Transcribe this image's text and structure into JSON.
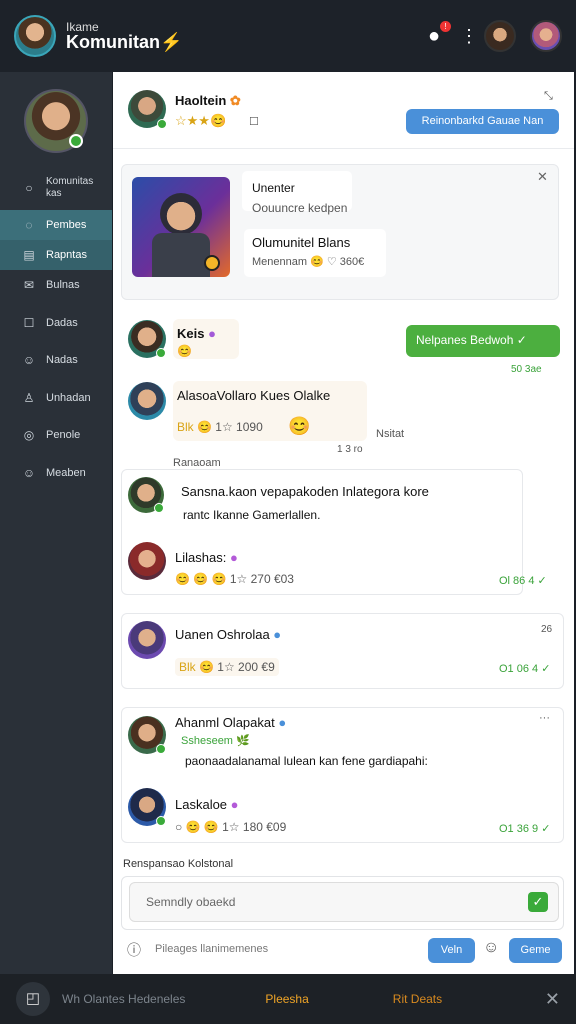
{
  "app": {
    "subtitle": "Ikame",
    "title": "Komunitan",
    "title_suffix": "⚡",
    "notif_count": "!"
  },
  "icons": {
    "bell": "bell-icon",
    "more": "more-vertical-icon",
    "close": "close-icon",
    "check": "check-icon"
  },
  "colors": {
    "accent": "#4a90d9",
    "success": "#4caf3f",
    "sidebar_active": "#3c6f7a",
    "brand_orange": "#f5a623"
  },
  "sidebar": {
    "items": [
      {
        "label": "Komunitas\nkas",
        "icon": "○"
      },
      {
        "label": "Pembes",
        "icon": "◌"
      },
      {
        "label": "Rapntas",
        "icon": "▤"
      },
      {
        "label": "Bulnas",
        "icon": "✉"
      },
      {
        "label": "Dadas",
        "icon": "☐"
      },
      {
        "label": "Nadas",
        "icon": "☺"
      },
      {
        "label": "Unhadan",
        "icon": "♙"
      },
      {
        "label": "Penole",
        "icon": "◎"
      },
      {
        "label": "Meaben",
        "icon": "☺"
      }
    ]
  },
  "header": {
    "name": "Haoltein",
    "stars": "☆★★😊",
    "extra": "☐",
    "action": "Reinonbarkd Gauae Nan",
    "close": "✕"
  },
  "feature": {
    "line1": "Unenter",
    "line2": "Oouuncre kedpen",
    "line3": "Olumunitel Blans",
    "line4": "Menennam 😊 ♡ 360€",
    "close": "✕"
  },
  "chat": {
    "m1": {
      "name": "Keis",
      "react": "😊"
    },
    "reply": {
      "label": "Nelpanes Bedwoh",
      "check": "✓",
      "meta": "50  3ae"
    },
    "m2": {
      "name": "AlasoaVollaro Kues Olalke",
      "react_label": "Blk",
      "react": "😊 1☆ 1090",
      "emoji": "😊",
      "meta": "Nsitat",
      "time": "1 3 ro"
    },
    "section_label": "Ranaoam",
    "m3": {
      "text": "Sansna.kaon vepapakoden Inlategora kore",
      "text2": "rantc Ikanne Gamerlallen.",
      "name": "Lilashas:",
      "reacts": "😊 😊 😊 1☆ 270 €03",
      "meta": "Ol 86 4 ✓"
    },
    "m4": {
      "name": "Uanen Oshrolaa",
      "react_label": "Blk",
      "react": "😊 1☆ 200 €9",
      "corner": "26",
      "meta": "O1 06 4 ✓"
    },
    "m5": {
      "name": "Ahanml Olapakat",
      "sub": "Ssheseem 🌿",
      "text": "paonaadalanamal lulean kan fene gardiapahi:",
      "name2": "Laskaloe",
      "reacts": "○ 😊 😊 1☆ 180 €09",
      "meta": "O1 36 9 ✓",
      "more": "···"
    },
    "footer_label": "Renspansao Kolstonal",
    "input_placeholder": "Semndly obaekd",
    "helper": "Pileages llanimemenes",
    "btn1": "Veln",
    "btn2": "Geme"
  },
  "bottom": {
    "label": "Wh Olantes Hedeneles",
    "orange1": "Pleesha",
    "orange2": "Rit Deats",
    "close": "✕"
  }
}
